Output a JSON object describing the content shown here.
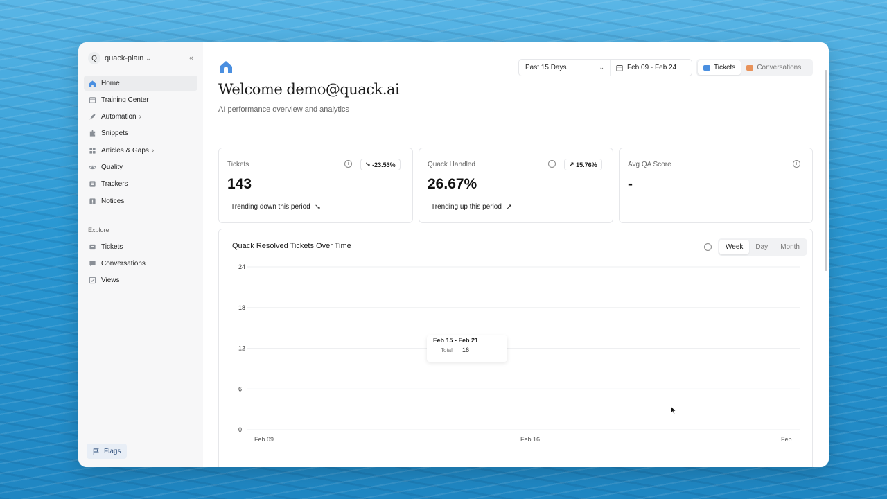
{
  "sidebar": {
    "workspace_initial": "Q",
    "workspace_name": "quack-plain",
    "items": [
      {
        "label": "Home",
        "icon": "home-icon",
        "active": true
      },
      {
        "label": "Training Center",
        "icon": "training-icon"
      },
      {
        "label": "Automation",
        "icon": "rocket-icon",
        "arrow": true
      },
      {
        "label": "Snippets",
        "icon": "puzzle-icon"
      },
      {
        "label": "Articles & Gaps",
        "icon": "articles-icon",
        "arrow": true
      },
      {
        "label": "Quality",
        "icon": "eye-icon"
      },
      {
        "label": "Trackers",
        "icon": "tracker-icon"
      },
      {
        "label": "Notices",
        "icon": "notice-icon"
      }
    ],
    "explore_label": "Explore",
    "explore_items": [
      {
        "label": "Tickets",
        "icon": "tickets-icon"
      },
      {
        "label": "Conversations",
        "icon": "conversations-icon"
      },
      {
        "label": "Views",
        "icon": "views-icon"
      }
    ],
    "flags_label": "Flags"
  },
  "header": {
    "welcome": "Welcome demo@quack.ai",
    "subtitle": "AI performance overview and analytics",
    "range_label": "Past 15 Days",
    "date_range": "Feb 09 - Feb 24",
    "toggle": [
      "Tickets",
      "Conversations"
    ],
    "toggle_active": "Tickets"
  },
  "cards": [
    {
      "label": "Tickets",
      "value": "143",
      "badge": "-23.53%",
      "badge_arrow": "↘",
      "trend": "Trending down this period",
      "trend_arrow": "↘"
    },
    {
      "label": "Quack Handled",
      "value": "26.67%",
      "badge": "15.76%",
      "badge_arrow": "↗",
      "trend": "Trending up this period",
      "trend_arrow": "↗"
    },
    {
      "label": "Avg QA Score",
      "value": "-"
    }
  ],
  "chart": {
    "title": "Quack Resolved Tickets Over Time",
    "periods": [
      "Week",
      "Day",
      "Month"
    ],
    "active_period": "Week",
    "tooltip_title": "Feb 15 - Feb 21",
    "tooltip_label": "Total",
    "tooltip_value": "16"
  },
  "chart_data": {
    "type": "bar",
    "title": "Quack Resolved Tickets Over Time",
    "y_ticks": [
      0,
      6,
      12,
      18,
      24
    ],
    "ylim": [
      0,
      24
    ],
    "x_ticks": [
      "Feb 09",
      "Feb 16",
      "Feb"
    ],
    "categories": [
      "Feb 15 - Feb 21"
    ],
    "values": [
      16
    ],
    "grid": true
  },
  "colors": {
    "accent": "#4a8fe0",
    "sidebar_bg": "#f7f7f8",
    "border": "#e6e7ea"
  }
}
